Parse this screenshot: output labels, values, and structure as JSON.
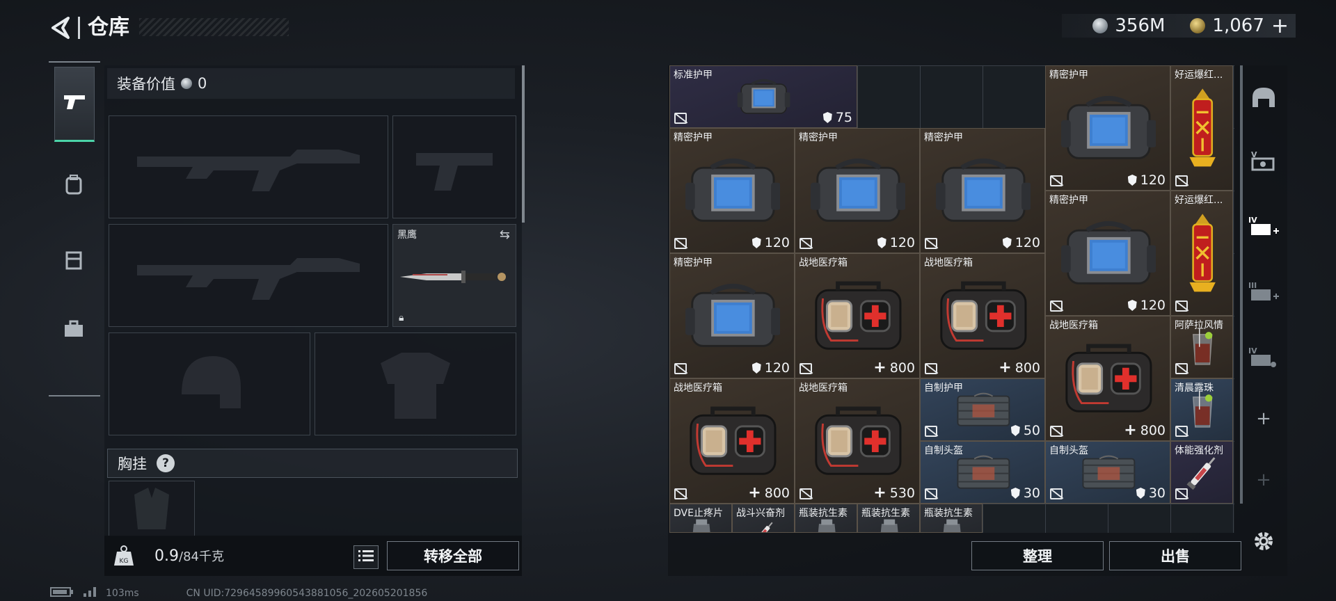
{
  "header": {
    "title": "仓库",
    "back_icon": "back-arrow-icon"
  },
  "currency": {
    "silver": "356M",
    "gold": "1,067",
    "gold_plus": "+"
  },
  "tabs": [
    "pistol-icon",
    "backpack-icon",
    "rig-icon",
    "toolbox-icon"
  ],
  "equipment": {
    "value_label": "装备价值",
    "value": "0",
    "knife_slot_label": "黑鹰",
    "chest_rig_label": "胸挂",
    "help": "?",
    "weight_current": "0.9",
    "weight_max": "/84千克",
    "transfer_all": "转移全部",
    "kg_label": "KG"
  },
  "status": {
    "ping": "103ms",
    "uid": "CN UID:7296458996054388​1056_202605201856"
  },
  "storage": {
    "items": [
      {
        "name": "标准护甲",
        "value": "75",
        "kind": "shield",
        "color": "purple",
        "img": "bag"
      },
      {
        "name": "精密护甲",
        "value": "120",
        "kind": "shield",
        "color": "brown",
        "img": "bag"
      },
      {
        "name": "好运爆红...",
        "value": "",
        "kind": "",
        "color": "brown",
        "img": "firecracker"
      },
      {
        "name": "精密护甲",
        "value": "120",
        "kind": "shield",
        "color": "brown",
        "img": "bag"
      },
      {
        "name": "精密护甲",
        "value": "120",
        "kind": "shield",
        "color": "brown",
        "img": "bag"
      },
      {
        "name": "精密护甲",
        "value": "120",
        "kind": "shield",
        "color": "brown",
        "img": "bag"
      },
      {
        "name": "精密护甲",
        "value": "120",
        "kind": "shield",
        "color": "brown",
        "img": "bag"
      },
      {
        "name": "好运爆红...",
        "value": "",
        "kind": "",
        "color": "brown",
        "img": "firecracker"
      },
      {
        "name": "精密护甲",
        "value": "120",
        "kind": "shield",
        "color": "brown",
        "img": "bag"
      },
      {
        "name": "战地医疗箱",
        "value": "800",
        "kind": "plus",
        "color": "brown",
        "img": "medkit"
      },
      {
        "name": "战地医疗箱",
        "value": "800",
        "kind": "plus",
        "color": "brown",
        "img": "medkit"
      },
      {
        "name": "战地医疗箱",
        "value": "800",
        "kind": "plus",
        "color": "brown",
        "img": "medkit"
      },
      {
        "name": "阿萨拉风情",
        "value": "",
        "kind": "",
        "color": "brown",
        "img": "drink"
      },
      {
        "name": "战地医疗箱",
        "value": "800",
        "kind": "plus",
        "color": "brown",
        "img": "medkit"
      },
      {
        "name": "战地医疗箱",
        "value": "530",
        "kind": "plus",
        "color": "brown",
        "img": "medkit"
      },
      {
        "name": "自制护甲",
        "value": "50",
        "kind": "shield",
        "color": "blue",
        "img": "vest"
      },
      {
        "name": "清晨露珠",
        "value": "",
        "kind": "",
        "color": "blue",
        "img": "drink"
      },
      {
        "name": "自制头盔",
        "value": "30",
        "kind": "shield",
        "color": "blue",
        "img": "vest"
      },
      {
        "name": "自制头盔",
        "value": "30",
        "kind": "shield",
        "color": "blue",
        "img": "vest"
      },
      {
        "name": "体能强化剂",
        "value": "",
        "kind": "",
        "color": "purple",
        "img": "syringe"
      },
      {
        "name": "DVE止疼片",
        "value": "",
        "kind": "",
        "color": "dark",
        "img": "pill"
      },
      {
        "name": "战斗兴奋剂",
        "value": "",
        "kind": "",
        "color": "dark",
        "img": "syringe"
      },
      {
        "name": "瓶装抗生素",
        "value": "",
        "kind": "",
        "color": "dark",
        "img": "pill"
      },
      {
        "name": "瓶装抗生素",
        "value": "",
        "kind": "",
        "color": "dark",
        "img": "pill"
      },
      {
        "name": "瓶装抗生素",
        "value": "",
        "kind": "",
        "color": "dark",
        "img": "pill"
      }
    ],
    "sort": "整理",
    "sell": "出售"
  },
  "sidebar": [
    "helmet-icon",
    "v-card-icon",
    "iv-card-add-icon",
    "iii-card-add-icon",
    "iv-card-icon",
    "add-icon",
    "add-icon",
    "settings-icon"
  ],
  "colors": {
    "accent": "#4bd4a8"
  }
}
